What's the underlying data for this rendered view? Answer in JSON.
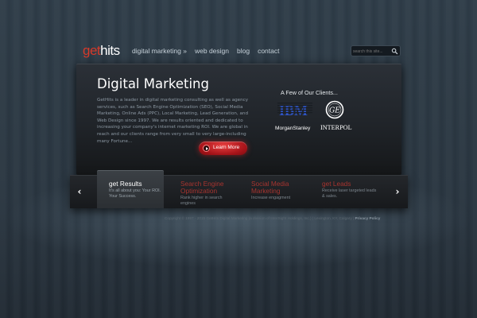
{
  "header": {
    "logo_get": "get",
    "logo_hits": "hits",
    "nav": [
      {
        "label": "digital marketing »"
      },
      {
        "label": "web design"
      },
      {
        "label": "blog"
      },
      {
        "label": "contact"
      }
    ],
    "search": {
      "placeholder": "search this site...",
      "icon": "search-icon"
    }
  },
  "hero": {
    "title": "Digital Marketing",
    "text": "GetHits is a leader in digital marketing consulting as well as agency services, such as Search Engine Optimization (SEO), Social Media Marketing, Online Ads (PPC), Local Marketing, Lead Generation, and Web Design since 1997. We are results oriented and dedicated to increasing your company's internet marketing ROI. We are global in reach and our clients range from very small to very large-including many Fortune...",
    "button_label": "Learn More"
  },
  "clients": {
    "heading": "A Few of Our Clients...",
    "logos": [
      {
        "name": "IBM",
        "text": "IBM"
      },
      {
        "name": "GE",
        "text": "GE"
      },
      {
        "name": "Morgan Stanley",
        "text": "MorganStanley"
      },
      {
        "name": "Interpol",
        "text": "INTERPOL"
      }
    ]
  },
  "slider": {
    "prev_icon": "chevron-left-icon",
    "next_icon": "chevron-right-icon",
    "items": [
      {
        "title": "get Results",
        "desc": "It's all about you: Your ROI. Your Success."
      },
      {
        "title": "Search Engine Optimization",
        "desc": "Rank higher in search engines"
      },
      {
        "title": "Social Media Marketing",
        "desc": "Increase engagment"
      },
      {
        "title": "get Leads",
        "desc": "Receive laser targeted leads & sales."
      }
    ]
  },
  "footer": {
    "text": "Copyright © 1997 - 2015 GetHits Digital Marketing (a division of InterSight Holdings, Inc.) | Lexington, KY, Calgary | ",
    "link": "Privacy Policy"
  },
  "colors": {
    "accent_red": "#d63a2a",
    "slide_red": "#a7342f",
    "background": "#2c3944"
  }
}
